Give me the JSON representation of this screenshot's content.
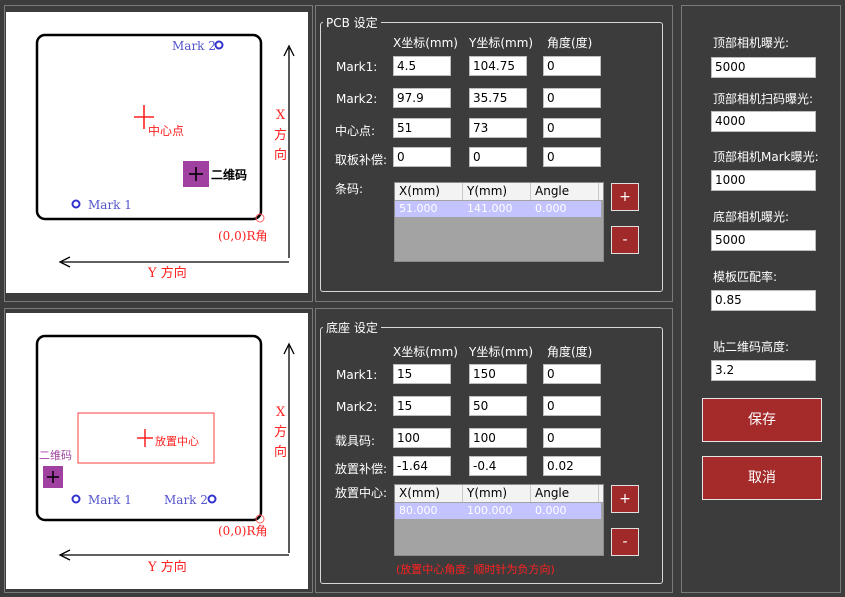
{
  "colors": {
    "background": "#3c3c3c",
    "accent_button": "#a52a2a",
    "diagram_red": "#ff3030",
    "diagram_blue": "#5555cc",
    "qr_purple": "#a040a0",
    "grid_selected": "#c3c3ff"
  },
  "pcb_diagram": {
    "mark2": "Mark 2",
    "mark1": "Mark 1",
    "center": "中心点",
    "qr": "二维码",
    "origin": "(0,0)R角",
    "y_dir": "Y 方向",
    "x_dir": [
      "X",
      "方",
      "向"
    ]
  },
  "base_diagram": {
    "mark1": "Mark 1",
    "mark2": "Mark 2",
    "place_center": "放置中心",
    "qr": "二维码",
    "origin": "(0,0)R角",
    "y_dir": "Y 方向",
    "x_dir": [
      "X",
      "方",
      "向"
    ]
  },
  "pcb_settings": {
    "title": "PCB 设定",
    "col_x": "X坐标(mm)",
    "col_y": "Y坐标(mm)",
    "col_angle": "角度(度)",
    "rows": [
      {
        "label": "Mark1:",
        "x": "4.5",
        "y": "104.75",
        "angle": "0"
      },
      {
        "label": "Mark2:",
        "x": "97.9",
        "y": "35.75",
        "angle": "0"
      },
      {
        "label": "中心点:",
        "x": "51",
        "y": "73",
        "angle": "0"
      },
      {
        "label": "取板补偿:",
        "x": "0",
        "y": "0",
        "angle": "0"
      }
    ],
    "barcode_label": "条码:",
    "grid": {
      "headers": [
        "X(mm)",
        "Y(mm)",
        "Angle"
      ],
      "row": [
        "51.000",
        "141.000",
        "0.000"
      ]
    },
    "add": "+",
    "remove": "-"
  },
  "base_settings": {
    "title": "底座 设定",
    "col_x": "X坐标(mm)",
    "col_y": "Y坐标(mm)",
    "col_angle": "角度(度)",
    "rows": [
      {
        "label": "Mark1:",
        "x": "15",
        "y": "150",
        "angle": "0"
      },
      {
        "label": "Mark2:",
        "x": "15",
        "y": "50",
        "angle": "0"
      },
      {
        "label": "载具码:",
        "x": "100",
        "y": "100",
        "angle": "0"
      },
      {
        "label": "放置补偿:",
        "x": "-1.64",
        "y": "-0.4",
        "angle": "0.02"
      }
    ],
    "center_label": "放置中心:",
    "grid": {
      "headers": [
        "X(mm)",
        "Y(mm)",
        "Angle"
      ],
      "row": [
        "80.000",
        "100.000",
        "0.000"
      ]
    },
    "add": "+",
    "remove": "-",
    "note": "(放置中心角度: 顺时针为负方向)"
  },
  "right_panel": {
    "fields": [
      {
        "label": "顶部相机曝光:",
        "value": "5000"
      },
      {
        "label": "顶部相机扫码曝光:",
        "value": "4000"
      },
      {
        "label": "顶部相机Mark曝光:",
        "value": "1000"
      },
      {
        "label": "底部相机曝光:",
        "value": "5000"
      },
      {
        "label": "模板匹配率:",
        "value": "0.85"
      },
      {
        "label": "贴二维码高度:",
        "value": "3.2"
      }
    ],
    "save": "保存",
    "cancel": "取消"
  }
}
